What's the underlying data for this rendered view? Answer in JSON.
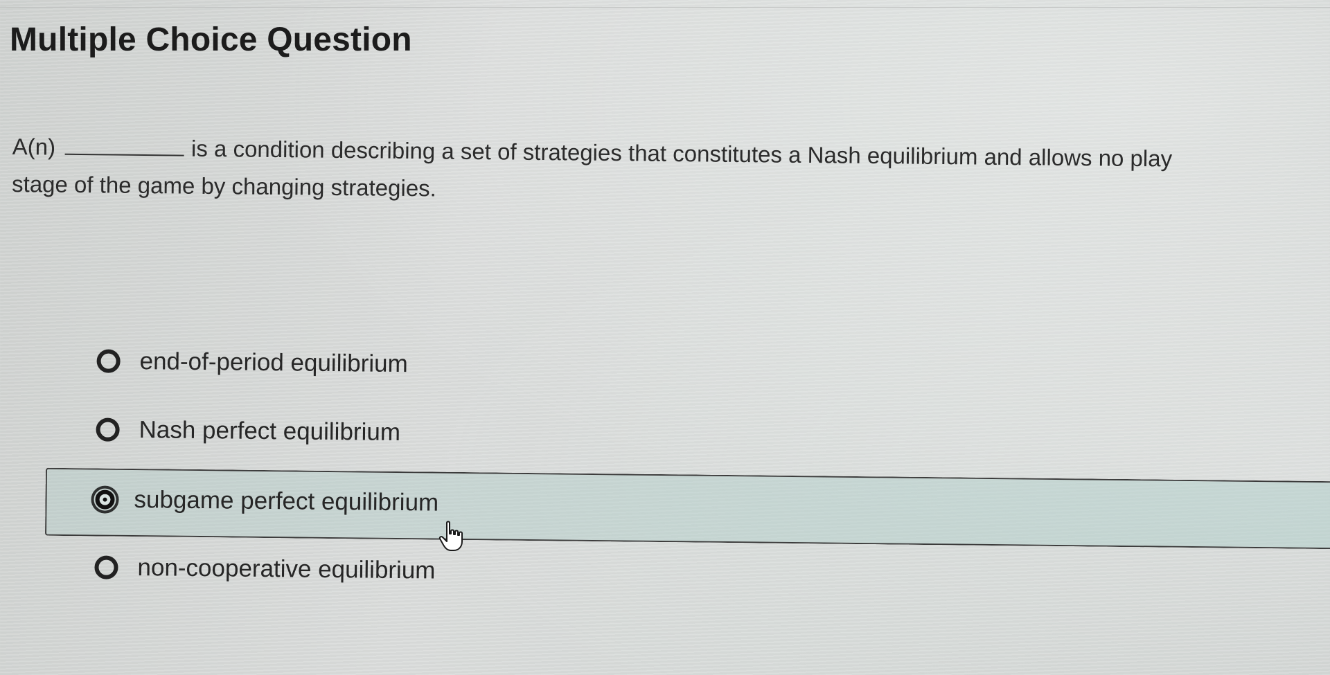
{
  "page": {
    "title": "Multiple Choice Question"
  },
  "question": {
    "prefix": "A(n)",
    "line1_rest": "is a condition describing a set of strategies that constitutes a Nash equilibrium and allows no play",
    "line2": "stage of the game by changing strategies."
  },
  "options": [
    {
      "label": "end-of-period equilibrium",
      "selected": false
    },
    {
      "label": "Nash perfect equilibrium",
      "selected": false
    },
    {
      "label": "subgame perfect equilibrium",
      "selected": true
    },
    {
      "label": "non-cooperative equilibrium",
      "selected": false
    }
  ],
  "colors": {
    "selected_highlight": "#b8d0cc",
    "text": "#262626"
  },
  "icons": {
    "radio": "radio-button-icon",
    "cursor": "hand-pointer-icon"
  }
}
